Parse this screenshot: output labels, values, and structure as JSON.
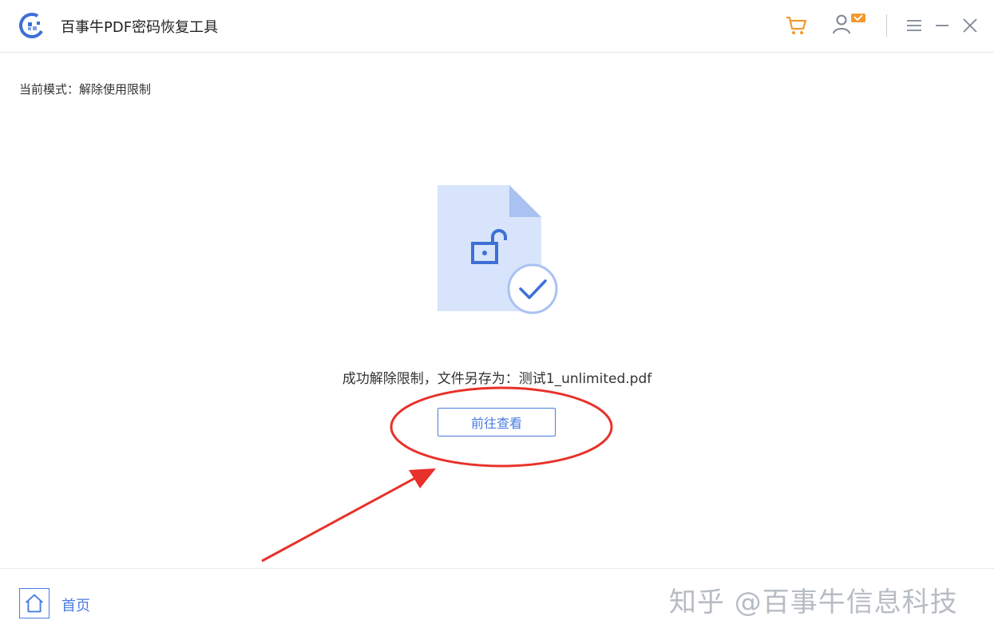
{
  "app": {
    "title": "百事牛PDF密码恢复工具"
  },
  "mode": {
    "text": "当前模式：解除使用限制"
  },
  "result": {
    "message": "成功解除限制，文件另存为：测试1_unlimited.pdf"
  },
  "actions": {
    "view_label": "前往查看"
  },
  "footer": {
    "home_label": "首页",
    "watermark": "知乎 @百事牛信息科技"
  },
  "icons": [
    "app-logo-icon",
    "cart-icon",
    "user-vip-icon",
    "menu-icon",
    "minimize-icon",
    "close-icon",
    "home-icon",
    "document-unlock-icon",
    "check-icon"
  ],
  "colors": {
    "accent": "#4a7ce0",
    "cart": "#f29a2e",
    "annotation": "#e8312a",
    "doc_fill": "#d7e4fb",
    "doc_fold": "#a9c2f2"
  }
}
